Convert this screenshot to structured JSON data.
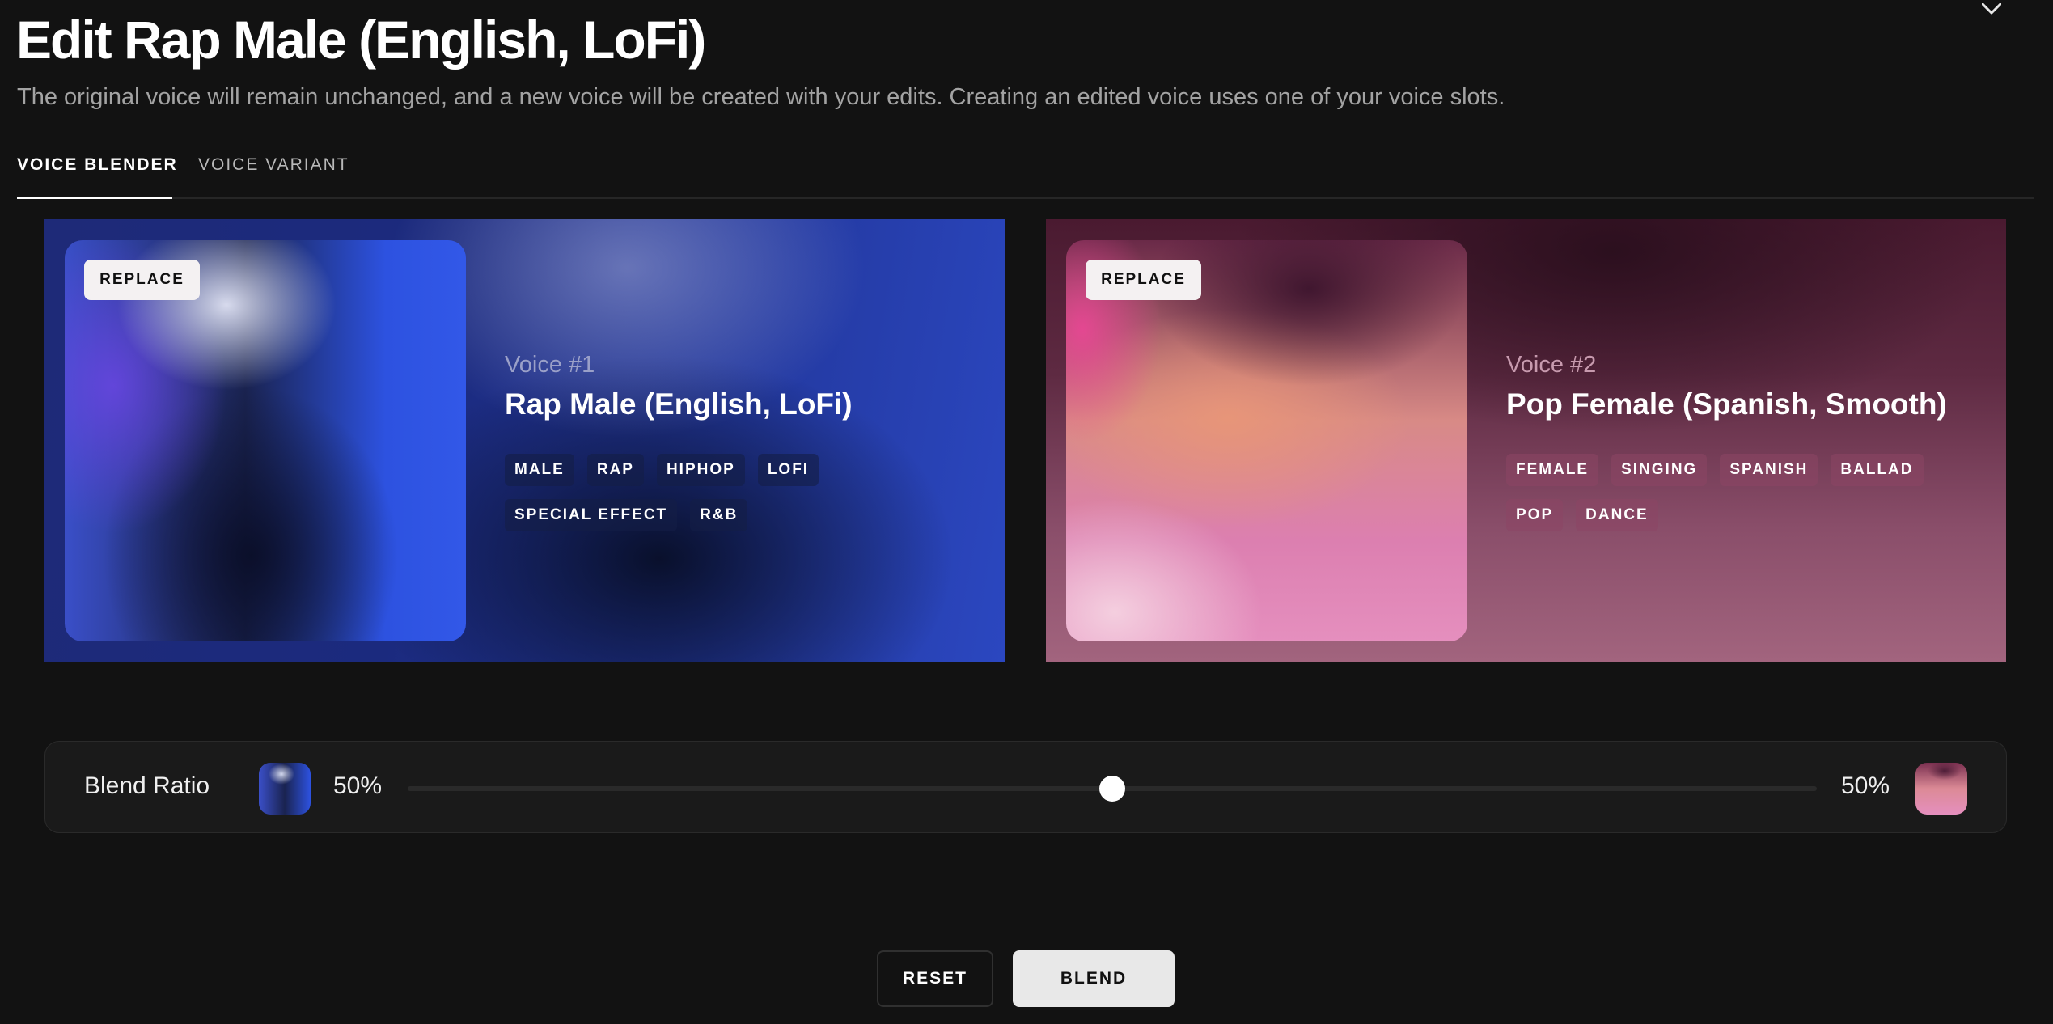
{
  "dialog": {
    "title": "Edit Rap Male (English, LoFi)",
    "subtitle": "The original voice will remain unchanged, and a new voice will be created with your edits. Creating an edited voice uses one of your voice slots.",
    "close_icon": "close-icon"
  },
  "tabs": [
    {
      "label": "VOICE BLENDER",
      "active": true
    },
    {
      "label": "VOICE VARIANT",
      "active": false
    }
  ],
  "voices": [
    {
      "replace_label": "REPLACE",
      "number_label": "Voice #1",
      "name": "Rap Male (English, LoFi)",
      "tags": [
        "MALE",
        "RAP",
        "HIPHOP",
        "LOFI",
        "SPECIAL EFFECT",
        "R&B"
      ],
      "accent": "#2b47c0"
    },
    {
      "replace_label": "REPLACE",
      "number_label": "Voice #2",
      "name": "Pop Female (Spanish, Smooth)",
      "tags": [
        "FEMALE",
        "SINGING",
        "SPANISH",
        "BALLAD",
        "POP",
        "DANCE"
      ],
      "accent": "#a2647e"
    }
  ],
  "blend": {
    "label": "Blend Ratio",
    "left_percent": "50%",
    "right_percent": "50%",
    "ratio": 0.5
  },
  "actions": {
    "reset_label": "RESET",
    "blend_label": "BLEND"
  }
}
